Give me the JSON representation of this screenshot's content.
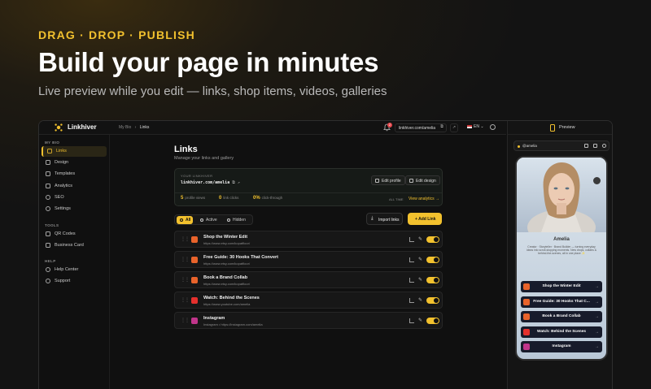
{
  "hero": {
    "eyebrow": "DRAG · DROP · PUBLISH",
    "title": "Build your page in minutes",
    "subtitle": "Live preview while you edit — links, shop items, videos, galleries"
  },
  "app": {
    "brand": "Linkhiver",
    "breadcrumb": {
      "parent": "My Bio",
      "sep": "›",
      "current": "Links"
    },
    "notification_count": "2",
    "url": "linkhiver.com/amelia",
    "language": "EN"
  },
  "sidebar": {
    "sections": [
      {
        "heading": "MY BIO",
        "items": [
          "Links",
          "Design",
          "Templates",
          "Analytics",
          "SEO",
          "Settings"
        ]
      },
      {
        "heading": "TOOLS",
        "items": [
          "QR Codes",
          "Business Card"
        ]
      },
      {
        "heading": "HELP",
        "items": [
          "Help Center",
          "Support"
        ]
      }
    ],
    "active": "Links"
  },
  "main": {
    "title": "Links",
    "subtitle": "Manage your links and gallery",
    "card": {
      "label": "YOUR LINKHIVER",
      "url": "linkhiver.com/amelia",
      "edit_profile": "Edit profile",
      "edit_design": "Edit design",
      "stats": [
        {
          "value": "5",
          "label": "profile views"
        },
        {
          "value": "0",
          "label": "link clicks"
        },
        {
          "value": "0%",
          "label": "click-through"
        }
      ],
      "period": "ALL TIME",
      "view_analytics": "View analytics →"
    },
    "filters": [
      "All",
      "Active",
      "Hidden"
    ],
    "active_filter": "All",
    "import_label": "Import links",
    "add_label": "+ Add Link",
    "links": [
      {
        "title": "Shop the Winter Edit",
        "url": "https://www.etsy.com/kopatfloor/",
        "icon_color": "#e8632b",
        "enabled": true
      },
      {
        "title": "Free Guide: 30 Hooks That Convert",
        "url": "https://www.etsy.com/kopatfloor/",
        "icon_color": "#e8632b",
        "enabled": true
      },
      {
        "title": "Book a Brand Collab",
        "url": "https://www.etsy.com/kopatfloor/",
        "icon_color": "#e8632b",
        "enabled": true
      },
      {
        "title": "Watch: Behind the Scenes",
        "url": "https://www.youtube.com/amelia",
        "icon_color": "#e5302d",
        "enabled": true
      },
      {
        "title": "Instagram",
        "url": "Instagram • https://instagram.com/amelia",
        "icon_color": "#c1358b",
        "enabled": true
      }
    ]
  },
  "preview": {
    "label": "Preview",
    "handle": "@amelia",
    "name": "Amelia",
    "bio": "Creator · Storyteller · Brand Builder — turning everyday ideas into scroll-stopping moments. New drops, collabs & behind-the-scenes, all in one place ✨",
    "links": [
      {
        "title": "Shop the Winter Edit",
        "icon_color": "#e8632b"
      },
      {
        "title": "Free Guide: 30 Hooks That C...",
        "icon_color": "#e8632b"
      },
      {
        "title": "Book a Brand Collab",
        "icon_color": "#e8632b"
      },
      {
        "title": "Watch: Behind the Scenes",
        "icon_color": "#e5302d"
      },
      {
        "title": "Instagram",
        "icon_color": "#c1358b"
      }
    ]
  },
  "colors": {
    "accent": "#f2c12e",
    "bg": "#101010",
    "panel": "#171717"
  }
}
